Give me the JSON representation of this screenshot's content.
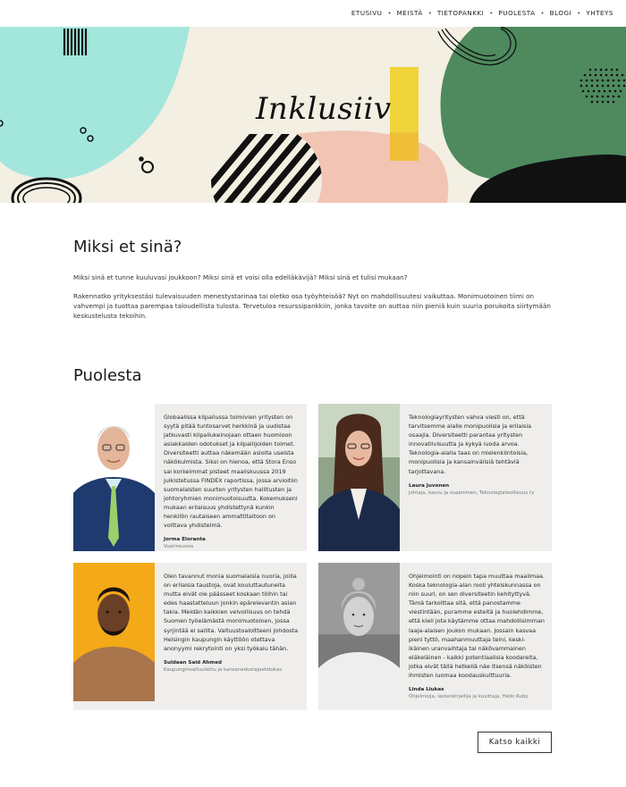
{
  "nav": {
    "items": [
      {
        "label": "ETUSIVU"
      },
      {
        "label": "MEISTÄ"
      },
      {
        "label": "TIETOPANKKI"
      },
      {
        "label": "PUOLESTA"
      },
      {
        "label": "BLOGI"
      },
      {
        "label": "YHTEYS"
      }
    ],
    "separator": "•"
  },
  "hero": {
    "title": "Inklusiiv",
    "colors": {
      "background": "#f3efe3",
      "teal": "#a3e6dc",
      "green": "#4e8a5e",
      "pink": "#f2c4b4",
      "yellow": "#f0d53a",
      "black": "#111111"
    }
  },
  "section_why": {
    "heading": "Miksi et sinä?",
    "para1": "Miksi sinä et tunne kuuluvasi joukkoon? Miksi sinä et voisi olla edelläkävijä? Miksi sinä et tulisi mukaan?",
    "para2": "Rakennatko yrityksestäsi tulevaisuuden menestystarinaa tai oletko osa työyhteisöä? Nyt on mahdollisuutesi vaikuttaa. Monimuotoinen tiimi on vahvempi ja tuottaa parempaa taloudellista tulosta. Tervetuloa resurssipankkiin, jonka tavoite on auttaa niin pieniä kuin suuria porukoita siirtymään keskustelusta tekoihin."
  },
  "section_advocates": {
    "heading": "Puolesta",
    "cards": [
      {
        "quote": "Globaalissa kilpailussa toimivien yritysten on syytä pitää tuntosarvet herkkinä ja uudistaa jatkuvasti kilpailukeinojaan ottaen huomioon asiakkaiden odotukset ja kilpailijoiden toimet. Diversiteetti auttaa näkemään asioita useista näkökulmista. Siksi on hienoa, että Stora Enso sai korkeimmat pisteet maaliskuussa 2019 julkistetussa FINDEX raportissa, jossa arvioitiin suomalaisten suurten yritysten hallitusten ja johtoryhmien monimuotoisuutta. Kokemukseni mukaan erilaisuus yhdistettynä kunkin henkilön rautaiseen ammattitaitoon on voittava yhdistelmä.",
        "name": "Jorma Eloranta",
        "role": "Vuorineuvos",
        "photo": "portrait-older-man-suit"
      },
      {
        "quote": "Teknologiayritysten vahva viesti on, että tarvitsemme alalle monipuolisia ja erilaisia osaajia. Diversiteetti parantaa yritysten innovatiivisuutta ja kykyä luoda arvoa. Teknologia-alalla taas on mielenkiintoisia, monipuolisia ja kansainvälisiä tehtäviä tarjottavana.",
        "name": "Laura Juvonen",
        "role": "Johtaja, kasvu ja osaaminen, Teknologiateollisuus ry",
        "photo": "portrait-woman-glasses"
      },
      {
        "quote": "Olen tavannut monia suomalaisia nuoria, joilla on erilaisia taustoja, ovat kouluttautuneita mutta eivät ole päässeet koskaan töihin tai edes haastatteluun jonkin epärelevantin asian takia. Meidän kaikkien velvollisuus on tehdä Suomen työelämästä monimuotoinen, jossa syrjintää ei sallita. Valtuustoaloitteeni johdosta Helsingin kaupungin käyttöön otettava anonyymi rekrytointi on yksi työkalu tähän.",
        "name": "Suldaan Said Ahmed",
        "role": "Kaupunginvaltuutettu ja kansanedustajaehdokas",
        "photo": "portrait-man-yellow-background"
      },
      {
        "quote": "Ohjelmointi on nopein tapa muuttaa maailmaa. Koska teknologia-alan rooli yhteiskunnassa on niin suuri, on sen diversiteetin kehityttyvä. Tämä tarkoittaa sitä, että panostamme viestintään, puramme esteitä ja huolehdimme, että kieli jota käytämme ottaa mahdollisimman laaja-alaisen joukon mukaan. Jossain kasvaa pieni tyttö, maahanmuuttaja teini, keski-ikäinen uranvaihtaja tai näkövammainen eläkeläinen - kaikki potentiaalisia koodareita, jotka eivät tällä hetkellä näe itsensä näköisten ihmisten luomaa koodauskulttuuria.",
        "name": "Linda Liukas",
        "role": "Ohjelmoija, lastenkirjailija ja kuvittaja, Hello Ruby",
        "photo": "portrait-woman-black-white"
      }
    ],
    "button_label": "Katso kaikki"
  }
}
